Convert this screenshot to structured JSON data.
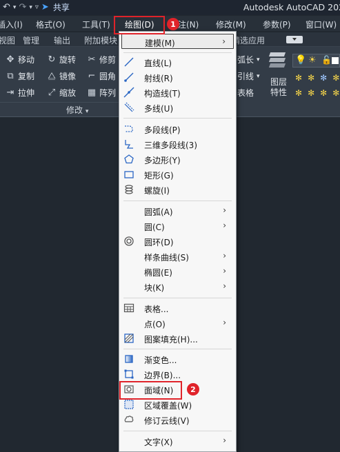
{
  "titlebar": {
    "share_label": "共享",
    "app_title": "Autodesk AutoCAD 202"
  },
  "menubar": {
    "items": [
      "插入(I)",
      "格式(O)",
      "工具(T)",
      "绘图(D)",
      "标注(N)",
      "修改(M)",
      "参数(P)",
      "窗口(W)"
    ],
    "partial_dim": "注(N)"
  },
  "ribbon_tabs": [
    "视图",
    "管理",
    "输出",
    "附加模块",
    "精选应用"
  ],
  "ribbon": {
    "modify_buttons": [
      {
        "label": "移动",
        "icon": "move-icon"
      },
      {
        "label": "旋转",
        "icon": "rotate-icon"
      },
      {
        "label": "修剪",
        "icon": "trim-icon"
      },
      {
        "label": "复制",
        "icon": "copy-icon"
      },
      {
        "label": "镜像",
        "icon": "mirror-icon"
      },
      {
        "label": "圆角",
        "icon": "fillet-icon"
      },
      {
        "label": "拉伸",
        "icon": "stretch-icon"
      },
      {
        "label": "缩放",
        "icon": "scale-icon"
      },
      {
        "label": "阵列",
        "icon": "array-icon"
      }
    ],
    "panel_title": "修改",
    "right_labels": {
      "arc_length": "弧长",
      "leader": "引线",
      "table": "表格",
      "layer_props_1": "图层",
      "layer_props_2": "特性"
    }
  },
  "dropdown": {
    "items": [
      {
        "label": "建模(M)",
        "icon": "",
        "submenu": true
      },
      {
        "label": "直线(L)",
        "icon": "line-icon",
        "submenu": false
      },
      {
        "label": "射线(R)",
        "icon": "ray-icon",
        "submenu": false
      },
      {
        "label": "构造线(T)",
        "icon": "xline-icon",
        "submenu": false
      },
      {
        "label": "多线(U)",
        "icon": "mline-icon",
        "submenu": false
      },
      {
        "label": "多段线(P)",
        "icon": "polyline-icon",
        "submenu": false
      },
      {
        "label": "三维多段线(3)",
        "icon": "3dpoly-icon",
        "submenu": false
      },
      {
        "label": "多边形(Y)",
        "icon": "polygon-icon",
        "submenu": false
      },
      {
        "label": "矩形(G)",
        "icon": "rectangle-icon",
        "submenu": false
      },
      {
        "label": "螺旋(I)",
        "icon": "helix-icon",
        "submenu": false
      },
      {
        "label": "圆弧(A)",
        "icon": "",
        "submenu": true
      },
      {
        "label": "圆(C)",
        "icon": "",
        "submenu": true
      },
      {
        "label": "圆环(D)",
        "icon": "donut-icon",
        "submenu": false
      },
      {
        "label": "样条曲线(S)",
        "icon": "",
        "submenu": true
      },
      {
        "label": "椭圆(E)",
        "icon": "",
        "submenu": true
      },
      {
        "label": "块(K)",
        "icon": "",
        "submenu": true
      },
      {
        "label": "表格...",
        "icon": "table-icon",
        "submenu": false
      },
      {
        "label": "点(O)",
        "icon": "",
        "submenu": true
      },
      {
        "label": "图案填充(H)...",
        "icon": "hatch-icon",
        "submenu": false
      },
      {
        "label": "渐变色...",
        "icon": "gradient-icon",
        "submenu": false
      },
      {
        "label": "边界(B)...",
        "icon": "boundary-icon",
        "submenu": false
      },
      {
        "label": "面域(N)",
        "icon": "region-icon",
        "submenu": false
      },
      {
        "label": "区域覆盖(W)",
        "icon": "wipeout-icon",
        "submenu": false
      },
      {
        "label": "修订云线(V)",
        "icon": "revcloud-icon",
        "submenu": false
      },
      {
        "label": "文字(X)",
        "icon": "",
        "submenu": true
      }
    ],
    "submenu_arrow": "›"
  },
  "annotations": {
    "badge_1": "1",
    "badge_2": "2"
  },
  "colors": {
    "accent_red": "#e0232a",
    "background": "#212830",
    "menu_bg": "#f7f7f7"
  }
}
